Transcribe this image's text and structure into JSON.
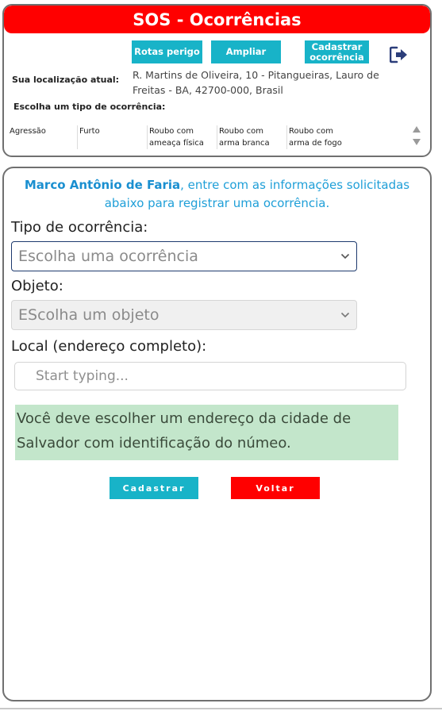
{
  "header": {
    "title": "SOS - Ocorrências",
    "buttons": {
      "rotas": "Rotas perigo",
      "ampliar": "Ampliar",
      "cadastrar": "Cadastrar ocorrência"
    },
    "location_label": "Sua localização atual:",
    "location_address": "R. Martins de Oliveira, 10 - Pitangueiras, Lauro de Freitas - BA, 42700-000, Brasil",
    "choose_label": "Escolha um tipo de ocorrência:",
    "types": [
      "Agressão",
      "Furto",
      "Roubo com ameaça física",
      "Roubo com arma branca",
      "Roubo com arma de fogo"
    ]
  },
  "form": {
    "user_name": "Marco Antônio de Faria",
    "intro_text": ", entre com as informações solicitadas abaixo para registrar uma ocorrência.",
    "tipo_label": "Tipo de ocorrência:",
    "tipo_placeholder": "Escolha uma ocorrência",
    "objeto_label": "Objeto:",
    "objeto_placeholder": "EScolha um objeto",
    "local_label": "Local (endereço completo):",
    "local_placeholder": "Start typing...",
    "local_value": "",
    "alert_text": "Você deve escolher um endereço da cidade de Salvador com identificação do númeo.",
    "submit_label": "Cadastrar",
    "back_label": "Voltar"
  },
  "colors": {
    "title_red": "#ff0000",
    "teal": "#18b3c8",
    "intro_blue": "#1f9fd8",
    "alert_green": "#c3e6cb"
  },
  "icons": [
    "sign-out-icon",
    "chevron-down-icon",
    "scroll-up-icon",
    "scroll-down-icon"
  ]
}
